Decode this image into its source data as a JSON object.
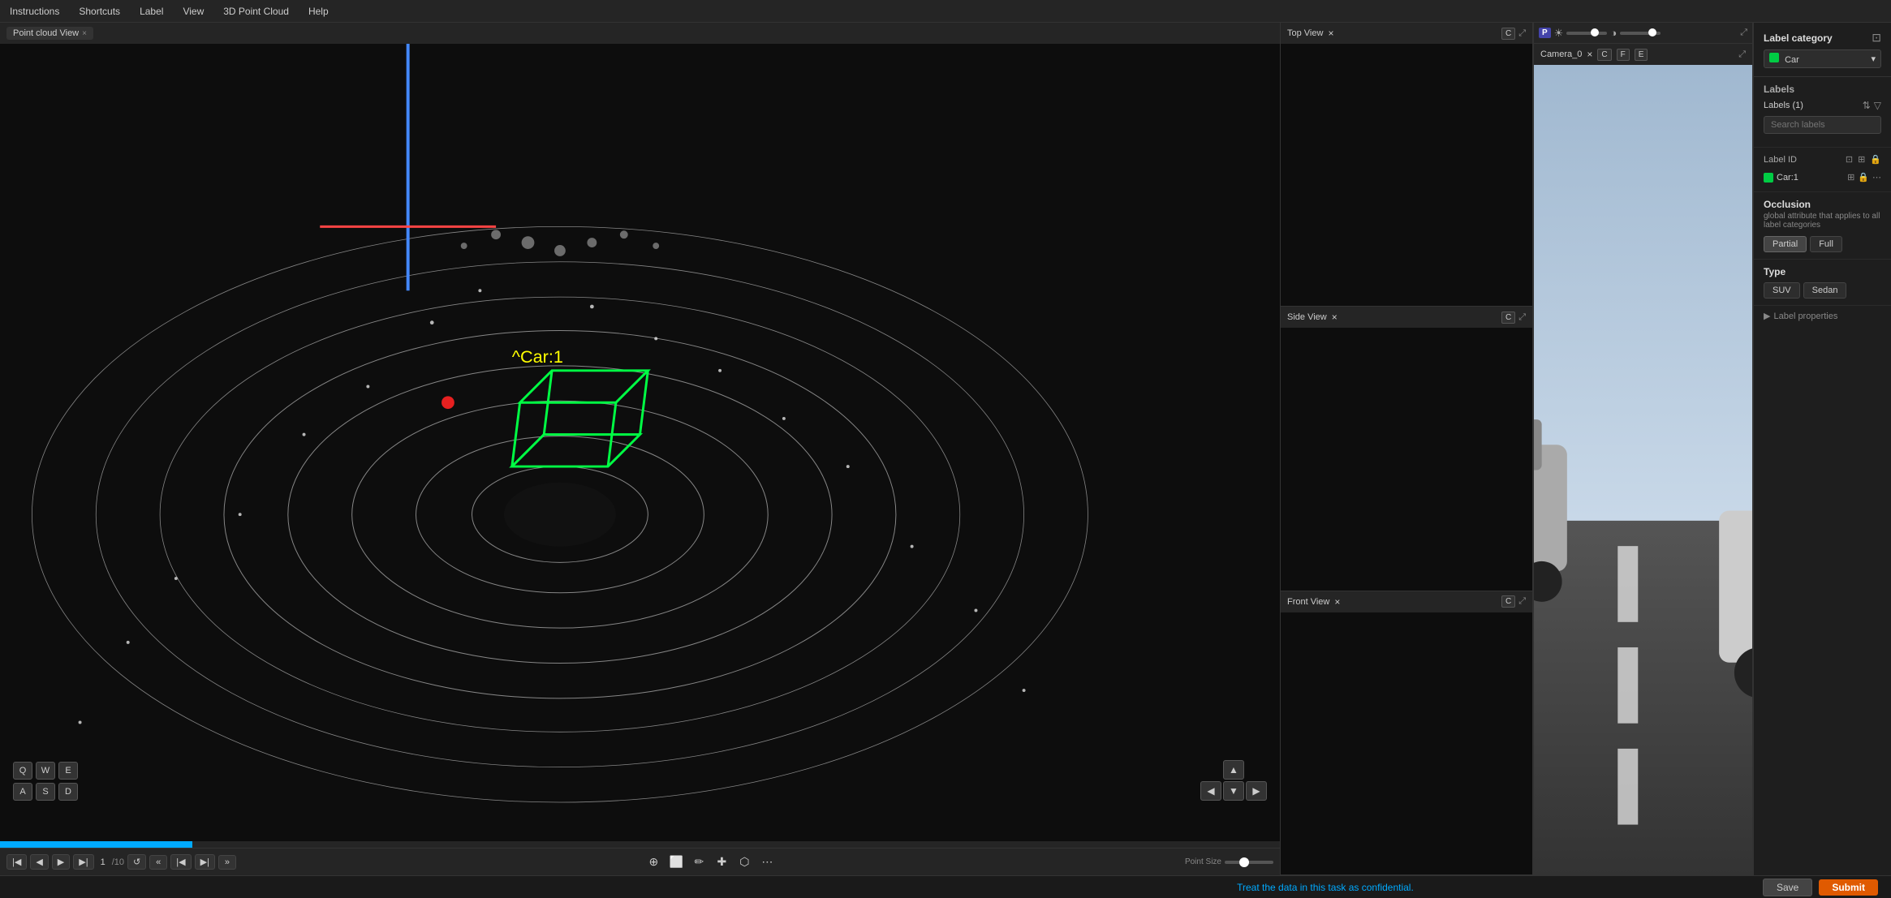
{
  "menubar": {
    "items": [
      "Instructions",
      "Shortcuts",
      "Label",
      "View",
      "3D Point Cloud",
      "Help"
    ]
  },
  "pointcloud_tab": {
    "label": "Point cloud View",
    "close": "×"
  },
  "top_view": {
    "label": "Top View",
    "close": "×",
    "badge": "C"
  },
  "side_view": {
    "label": "Side View",
    "close": "×",
    "badge": "C"
  },
  "front_view": {
    "label": "Front View",
    "close": "×",
    "badge": "C"
  },
  "camera_panel": {
    "label": "Camera_0",
    "close": "×",
    "badges": [
      "C",
      "F",
      "E"
    ]
  },
  "label_category": {
    "title": "Label category",
    "value": "Car",
    "color": "#00cc44"
  },
  "labels_section": {
    "title": "Labels",
    "count_label": "Labels (1)",
    "search_placeholder": "Search labels"
  },
  "label_id_section": {
    "title": "Label ID",
    "label_name": "Car:1",
    "color": "#00cc44"
  },
  "occlusion": {
    "title": "Occlusion",
    "description": "global attribute that applies to all label categories",
    "partial": "Partial",
    "full": "Full"
  },
  "type_section": {
    "title": "Type",
    "suv": "SUV",
    "sedan": "Sedan"
  },
  "label_properties": {
    "title": "Label properties"
  },
  "car_label": "^Car:1",
  "playback": {
    "frame_current": "1",
    "frame_total": "/10"
  },
  "point_size": "Point Size",
  "toolbar_tools": [
    "select",
    "box",
    "edit",
    "move",
    "polygon",
    "more"
  ],
  "status_bar": {
    "message": "Treat the data in this task as confidential.",
    "save": "Save",
    "submit": "Submit"
  },
  "keyboard": {
    "row1": [
      "Q",
      "W",
      "E"
    ],
    "row2": [
      "A",
      "S",
      "D"
    ]
  },
  "p_indicator": "P"
}
